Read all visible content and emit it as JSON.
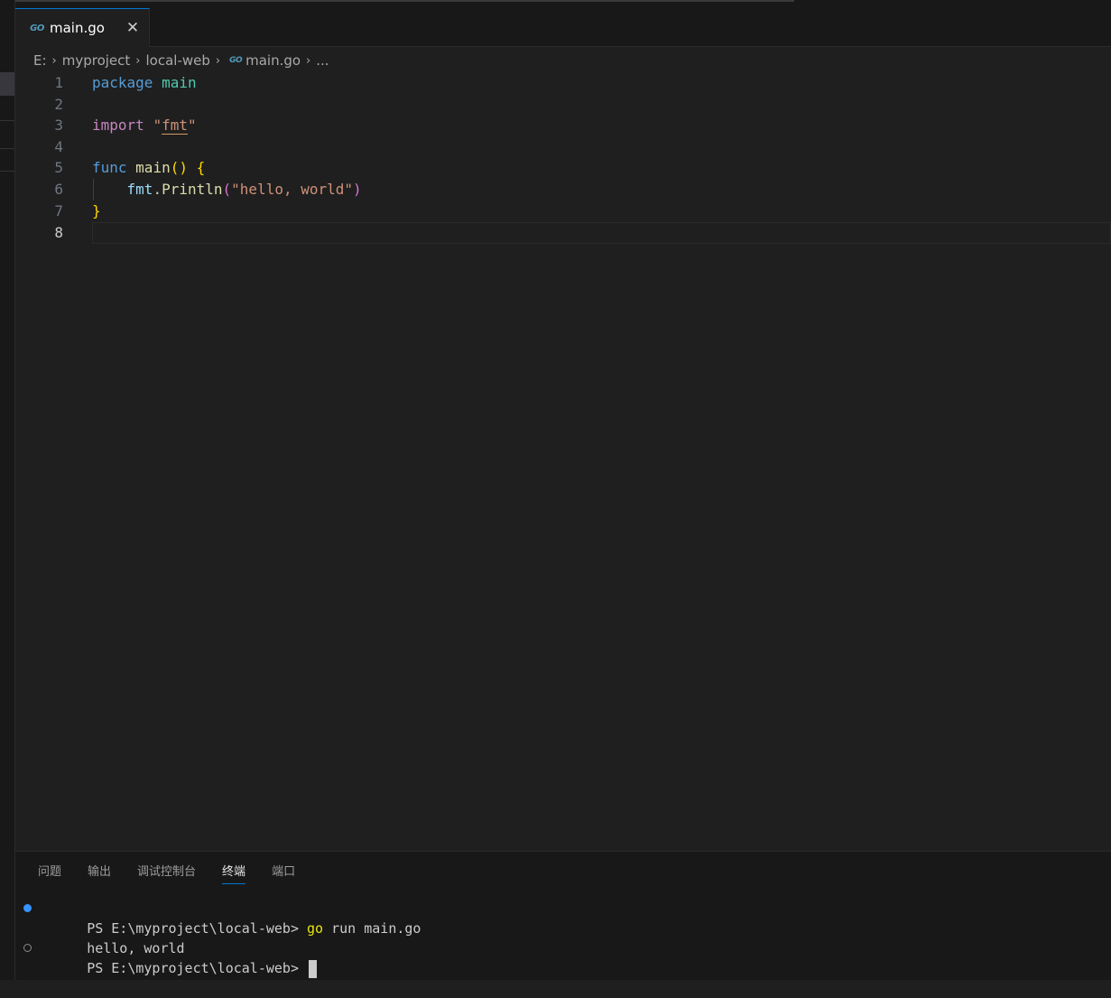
{
  "tab": {
    "label": "main.go",
    "icon": "go-file-icon",
    "close": "✕"
  },
  "breadcrumb": {
    "items": [
      "E:",
      "myproject",
      "local-web",
      "main.go",
      "..."
    ],
    "go_icon_text": "GO"
  },
  "editor": {
    "line_numbers": [
      "1",
      "2",
      "3",
      "4",
      "5",
      "6",
      "7",
      "8"
    ],
    "active_line": 8,
    "code": {
      "l1_kw": "package",
      "l1_name": "main",
      "l3_kw": "import",
      "l3_q1": "\"",
      "l3_pkg": "fmt",
      "l3_q2": "\"",
      "l5_kw": "func",
      "l5_fn": "main",
      "l5_paren": "()",
      "l5_brace": "{",
      "l6_pkg": "fmt",
      "l6_dot": ".",
      "l6_fn": "Println",
      "l6_open": "(",
      "l6_str": "\"hello, world\"",
      "l6_close": ")",
      "l7_brace": "}"
    }
  },
  "panel": {
    "tabs": [
      "问题",
      "输出",
      "调试控制台",
      "终端",
      "端口"
    ],
    "active_tab": "终端",
    "terminal": {
      "prompt1": "PS E:\\myproject\\local-web> ",
      "cmd_go": "go",
      "cmd_rest": " run main.go",
      "output": "hello, world",
      "prompt2": "PS E:\\myproject\\local-web> "
    }
  },
  "colors": {
    "accent": "#0078d4",
    "editor_bg": "#1f1f1f",
    "keyword": "#569cd6",
    "string": "#ce9178"
  }
}
